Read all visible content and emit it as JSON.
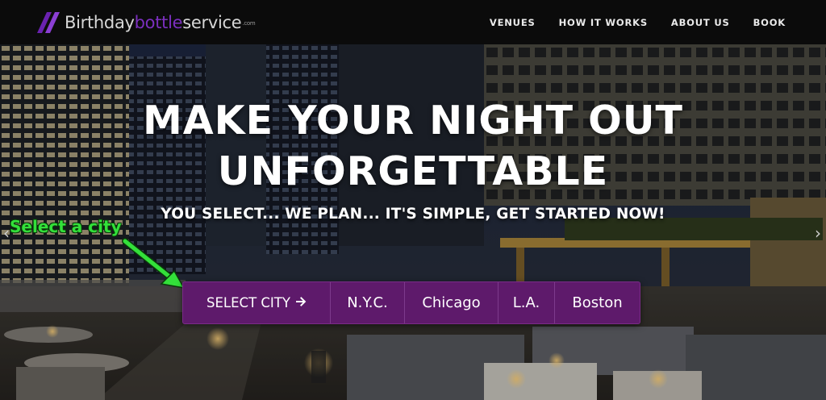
{
  "header": {
    "logo": {
      "part1": "Birthday",
      "part2": "bottle",
      "part3": "service",
      "tld": ".com"
    },
    "nav": [
      "VENUES",
      "HOW IT WORKS",
      "ABOUT US",
      "BOOK"
    ]
  },
  "hero": {
    "headline_line1": "MAKE YOUR NIGHT OUT",
    "headline_line2": "UNFORGETTABLE",
    "tagline": "YOU SELECT... WE PLAN... IT'S SIMPLE, GET STARTED NOW!",
    "hint": "Select a city",
    "select_label": "SELECT CITY",
    "cities": [
      "N.Y.C.",
      "Chicago",
      "L.A.",
      "Boston"
    ],
    "prev_arrow": "‹",
    "next_arrow": "›"
  },
  "colors": {
    "brand_purple": "#5e1a6b",
    "logo_accent": "#7b2fbe",
    "hint_green": "#33e03a",
    "header_bg": "#0b0b0b"
  },
  "icons": [
    "logo-mark-icon",
    "arrow-right-icon",
    "chevron-left-icon",
    "chevron-right-icon",
    "pointer-arrow-icon"
  ]
}
